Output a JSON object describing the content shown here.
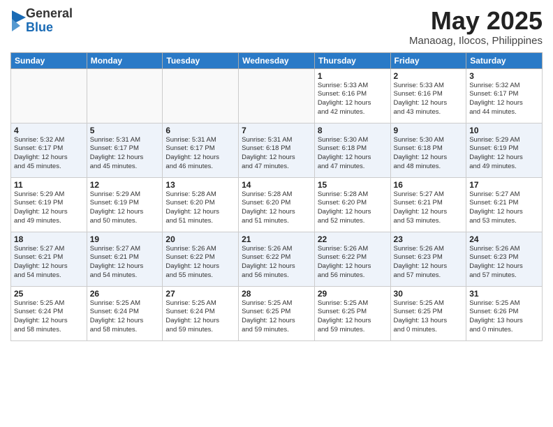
{
  "logo": {
    "general": "General",
    "blue": "Blue"
  },
  "title": "May 2025",
  "location": "Manaoag, Ilocos, Philippines",
  "days": [
    "Sunday",
    "Monday",
    "Tuesday",
    "Wednesday",
    "Thursday",
    "Friday",
    "Saturday"
  ],
  "weeks": [
    [
      {
        "day": "",
        "info": ""
      },
      {
        "day": "",
        "info": ""
      },
      {
        "day": "",
        "info": ""
      },
      {
        "day": "",
        "info": ""
      },
      {
        "day": "1",
        "info": "Sunrise: 5:33 AM\nSunset: 6:16 PM\nDaylight: 12 hours\nand 42 minutes."
      },
      {
        "day": "2",
        "info": "Sunrise: 5:33 AM\nSunset: 6:16 PM\nDaylight: 12 hours\nand 43 minutes."
      },
      {
        "day": "3",
        "info": "Sunrise: 5:32 AM\nSunset: 6:17 PM\nDaylight: 12 hours\nand 44 minutes."
      }
    ],
    [
      {
        "day": "4",
        "info": "Sunrise: 5:32 AM\nSunset: 6:17 PM\nDaylight: 12 hours\nand 45 minutes."
      },
      {
        "day": "5",
        "info": "Sunrise: 5:31 AM\nSunset: 6:17 PM\nDaylight: 12 hours\nand 45 minutes."
      },
      {
        "day": "6",
        "info": "Sunrise: 5:31 AM\nSunset: 6:17 PM\nDaylight: 12 hours\nand 46 minutes."
      },
      {
        "day": "7",
        "info": "Sunrise: 5:31 AM\nSunset: 6:18 PM\nDaylight: 12 hours\nand 47 minutes."
      },
      {
        "day": "8",
        "info": "Sunrise: 5:30 AM\nSunset: 6:18 PM\nDaylight: 12 hours\nand 47 minutes."
      },
      {
        "day": "9",
        "info": "Sunrise: 5:30 AM\nSunset: 6:18 PM\nDaylight: 12 hours\nand 48 minutes."
      },
      {
        "day": "10",
        "info": "Sunrise: 5:29 AM\nSunset: 6:19 PM\nDaylight: 12 hours\nand 49 minutes."
      }
    ],
    [
      {
        "day": "11",
        "info": "Sunrise: 5:29 AM\nSunset: 6:19 PM\nDaylight: 12 hours\nand 49 minutes."
      },
      {
        "day": "12",
        "info": "Sunrise: 5:29 AM\nSunset: 6:19 PM\nDaylight: 12 hours\nand 50 minutes."
      },
      {
        "day": "13",
        "info": "Sunrise: 5:28 AM\nSunset: 6:20 PM\nDaylight: 12 hours\nand 51 minutes."
      },
      {
        "day": "14",
        "info": "Sunrise: 5:28 AM\nSunset: 6:20 PM\nDaylight: 12 hours\nand 51 minutes."
      },
      {
        "day": "15",
        "info": "Sunrise: 5:28 AM\nSunset: 6:20 PM\nDaylight: 12 hours\nand 52 minutes."
      },
      {
        "day": "16",
        "info": "Sunrise: 5:27 AM\nSunset: 6:21 PM\nDaylight: 12 hours\nand 53 minutes."
      },
      {
        "day": "17",
        "info": "Sunrise: 5:27 AM\nSunset: 6:21 PM\nDaylight: 12 hours\nand 53 minutes."
      }
    ],
    [
      {
        "day": "18",
        "info": "Sunrise: 5:27 AM\nSunset: 6:21 PM\nDaylight: 12 hours\nand 54 minutes."
      },
      {
        "day": "19",
        "info": "Sunrise: 5:27 AM\nSunset: 6:21 PM\nDaylight: 12 hours\nand 54 minutes."
      },
      {
        "day": "20",
        "info": "Sunrise: 5:26 AM\nSunset: 6:22 PM\nDaylight: 12 hours\nand 55 minutes."
      },
      {
        "day": "21",
        "info": "Sunrise: 5:26 AM\nSunset: 6:22 PM\nDaylight: 12 hours\nand 56 minutes."
      },
      {
        "day": "22",
        "info": "Sunrise: 5:26 AM\nSunset: 6:22 PM\nDaylight: 12 hours\nand 56 minutes."
      },
      {
        "day": "23",
        "info": "Sunrise: 5:26 AM\nSunset: 6:23 PM\nDaylight: 12 hours\nand 57 minutes."
      },
      {
        "day": "24",
        "info": "Sunrise: 5:26 AM\nSunset: 6:23 PM\nDaylight: 12 hours\nand 57 minutes."
      }
    ],
    [
      {
        "day": "25",
        "info": "Sunrise: 5:25 AM\nSunset: 6:24 PM\nDaylight: 12 hours\nand 58 minutes."
      },
      {
        "day": "26",
        "info": "Sunrise: 5:25 AM\nSunset: 6:24 PM\nDaylight: 12 hours\nand 58 minutes."
      },
      {
        "day": "27",
        "info": "Sunrise: 5:25 AM\nSunset: 6:24 PM\nDaylight: 12 hours\nand 59 minutes."
      },
      {
        "day": "28",
        "info": "Sunrise: 5:25 AM\nSunset: 6:25 PM\nDaylight: 12 hours\nand 59 minutes."
      },
      {
        "day": "29",
        "info": "Sunrise: 5:25 AM\nSunset: 6:25 PM\nDaylight: 12 hours\nand 59 minutes."
      },
      {
        "day": "30",
        "info": "Sunrise: 5:25 AM\nSunset: 6:25 PM\nDaylight: 13 hours\nand 0 minutes."
      },
      {
        "day": "31",
        "info": "Sunrise: 5:25 AM\nSunset: 6:26 PM\nDaylight: 13 hours\nand 0 minutes."
      }
    ]
  ]
}
